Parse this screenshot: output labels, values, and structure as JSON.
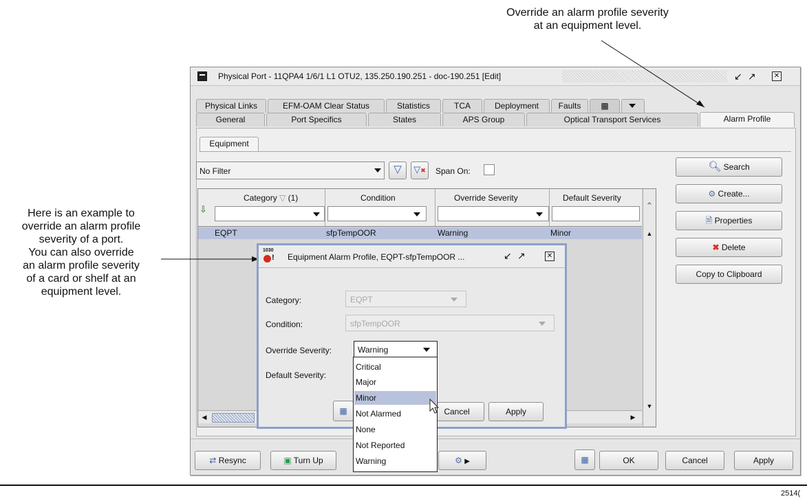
{
  "annotations": {
    "top_right": [
      "Override an alarm profile severity",
      "at an equipment level."
    ],
    "left": [
      "Here is an example to",
      "override an alarm profile",
      "severity of a port.",
      "You can also override",
      "an alarm profile severity",
      "of a card or shelf at an",
      "equipment level."
    ],
    "figure_number": "2514("
  },
  "window": {
    "title": "Physical Port - 11QPA4 1/6/1 L1 OTU2, 135.250.190.251 - doc-190.251 [Edit]",
    "tabs_row1": [
      "Physical Links",
      "EFM-OAM Clear Status",
      "Statistics",
      "TCA",
      "Deployment",
      "Faults"
    ],
    "tabs_row2": [
      "General",
      "Port Specifics",
      "States",
      "APS Group",
      "Optical Transport Services",
      "Alarm Profile"
    ],
    "subtab": "Equipment"
  },
  "filter": {
    "value": "No Filter",
    "span_on_label": "Span On:"
  },
  "table": {
    "columns": [
      "Category",
      "(1)",
      "Condition",
      "Override Severity",
      "Default Severity"
    ],
    "rows": [
      {
        "category": "EQPT",
        "condition": "sfpTempOOR",
        "override": "Warning",
        "default": "Minor"
      }
    ]
  },
  "side_buttons": {
    "search": "Search",
    "create": "Create...",
    "properties": "Properties",
    "delete": "Delete",
    "copy": "Copy to Clipboard"
  },
  "footer_buttons": {
    "resync": "Resync",
    "turn_up": "Turn Up",
    "ok": "OK",
    "cancel": "Cancel",
    "apply": "Apply"
  },
  "dialog": {
    "icon_text": "1030",
    "title": "Equipment Alarm Profile, EQPT-sfpTempOOR ...",
    "category_label": "Category:",
    "category_value": "EQPT",
    "condition_label": "Condition:",
    "condition_value": "sfpTempOOR",
    "override_label": "Override Severity:",
    "override_value": "Warning",
    "default_label": "Default Severity:",
    "cancel": "Cancel",
    "apply": "Apply"
  },
  "severity_options": [
    "Critical",
    "Major",
    "Minor",
    "Not Alarmed",
    "None",
    "Not Reported",
    "Warning"
  ],
  "highlighted_option": "Minor",
  "colors": {
    "selection": "#b9c2dc",
    "dialog_border": "#8ea0c8",
    "delete_icon": "#d8332b",
    "turn_up_icon": "#2a9a4a",
    "alarm_icon": "#d42a20"
  }
}
